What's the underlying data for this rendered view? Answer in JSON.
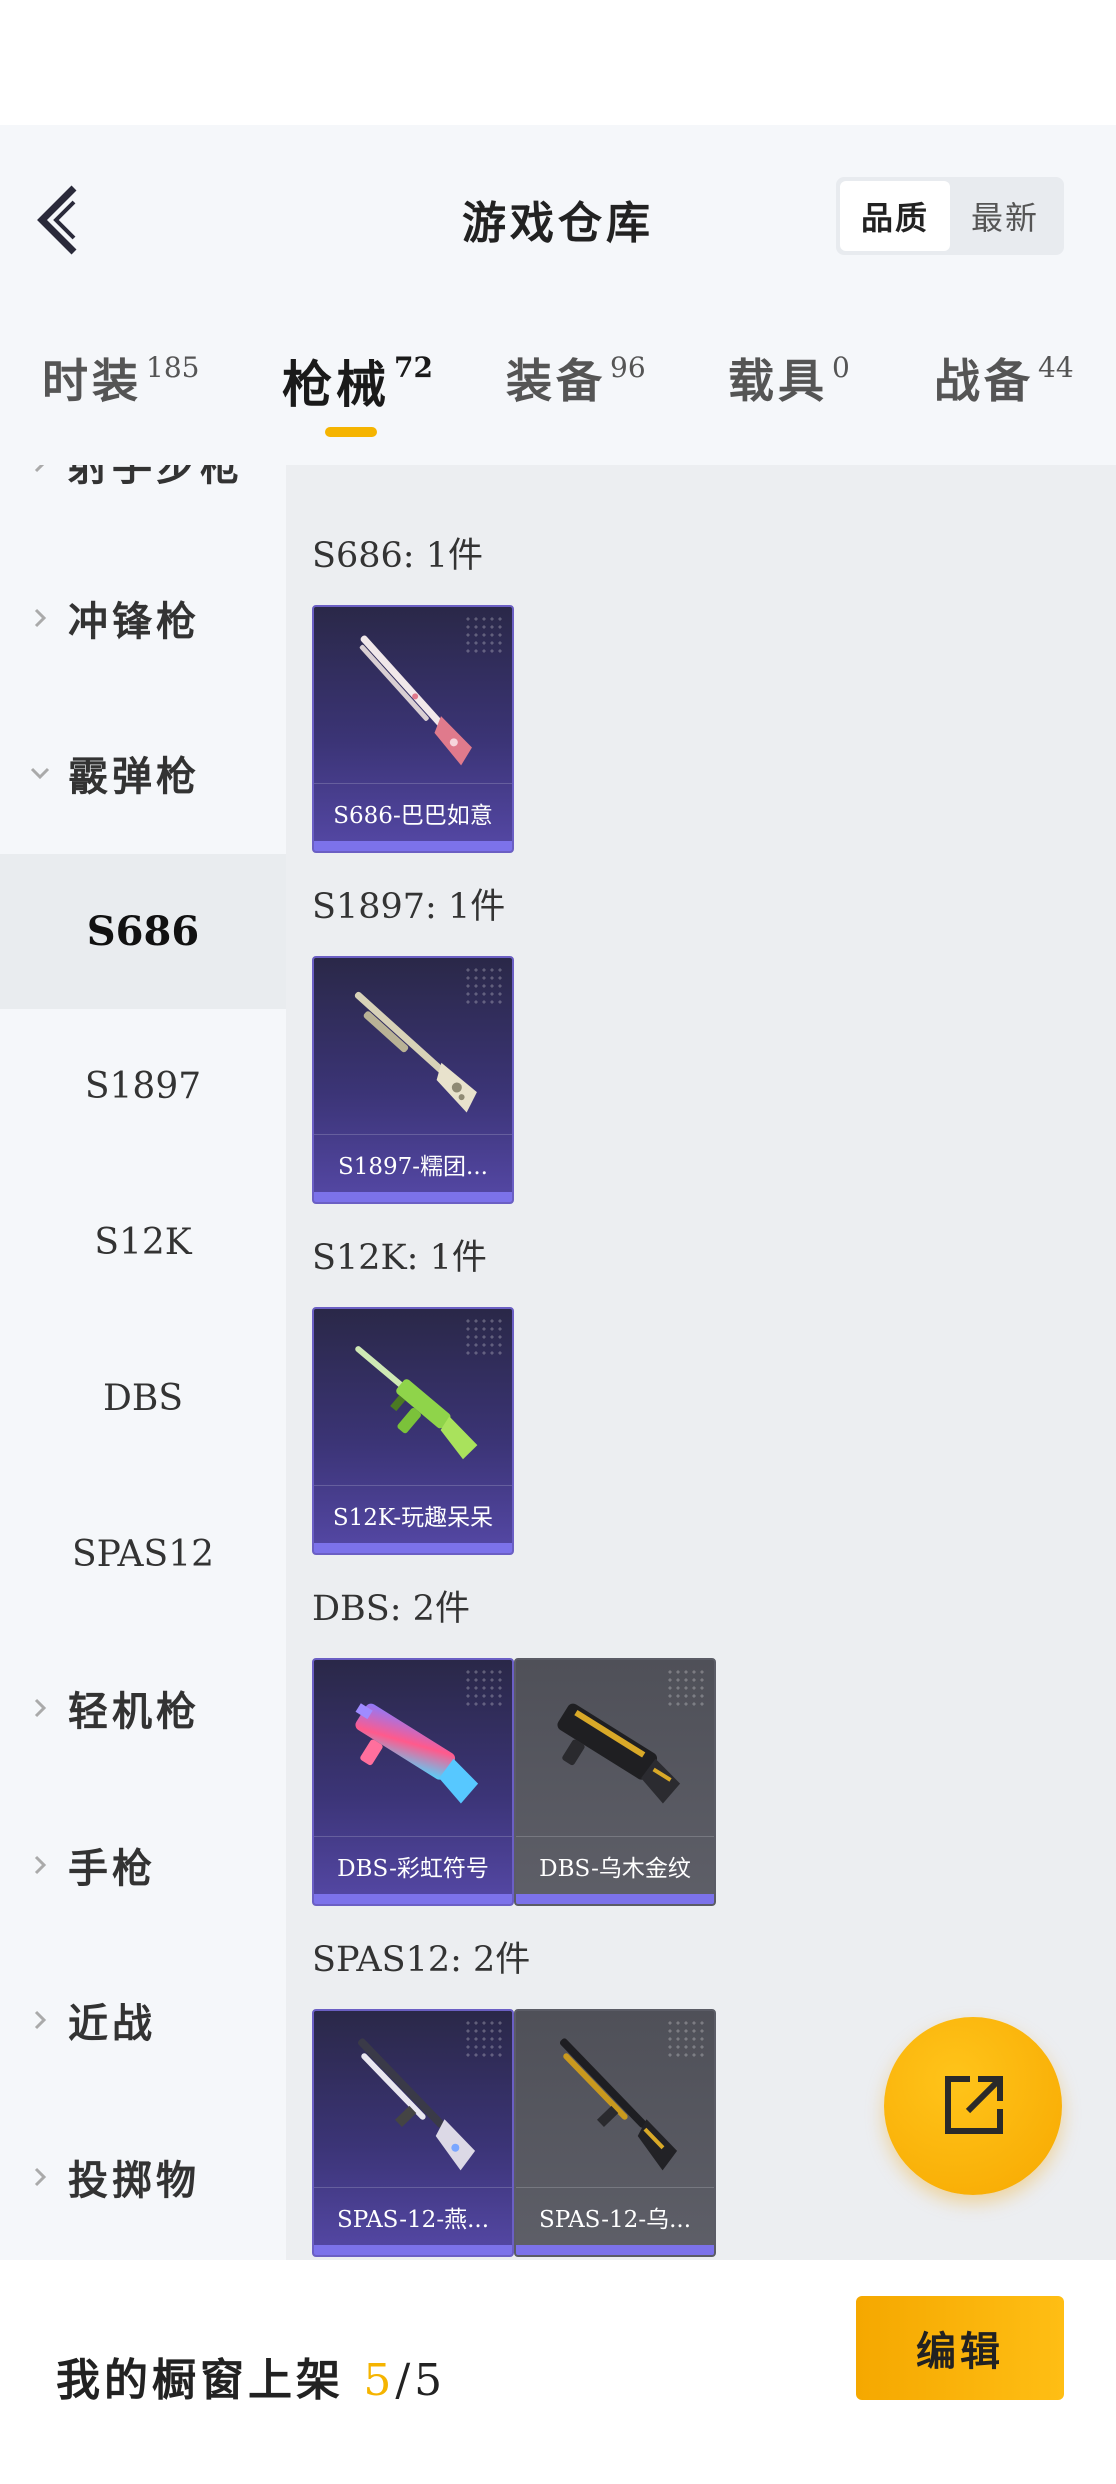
{
  "header": {
    "title": "游戏仓库",
    "sort_options": [
      "品质",
      "最新"
    ],
    "sort_active": "品质"
  },
  "tabs": [
    {
      "label": "时装",
      "count": "185"
    },
    {
      "label": "枪械",
      "count": "72",
      "active": true
    },
    {
      "label": "装备",
      "count": "96"
    },
    {
      "label": "载具",
      "count": "0"
    },
    {
      "label": "战备",
      "count": "44"
    }
  ],
  "sidebar": {
    "partial_top": "射手步枪",
    "categories": [
      {
        "label": "冲锋枪",
        "expanded": false
      },
      {
        "label": "霰弹枪",
        "expanded": true
      },
      {
        "label": "轻机枪",
        "expanded": false
      },
      {
        "label": "手枪",
        "expanded": false
      },
      {
        "label": "近战",
        "expanded": false
      },
      {
        "label": "投掷物",
        "expanded": false
      }
    ],
    "subitems": [
      "S686",
      "S1897",
      "S12K",
      "DBS",
      "SPAS12"
    ],
    "active_subitem": "S686"
  },
  "groups": [
    {
      "title": "S686: 1件",
      "items": [
        {
          "name": "S686-巴巴如意",
          "rarity": "purple"
        }
      ]
    },
    {
      "title": "S1897: 1件",
      "items": [
        {
          "name": "S1897-糯团...",
          "rarity": "purple"
        }
      ]
    },
    {
      "title": "S12K: 1件",
      "items": [
        {
          "name": "S12K-玩趣呆呆",
          "rarity": "purple"
        }
      ]
    },
    {
      "title": "DBS: 2件",
      "items": [
        {
          "name": "DBS-彩虹符号",
          "rarity": "purple"
        },
        {
          "name": "DBS-乌木金纹",
          "rarity": "gray"
        }
      ]
    },
    {
      "title": "SPAS12: 2件",
      "items": [
        {
          "name": "SPAS-12-燕...",
          "rarity": "purple"
        },
        {
          "name": "SPAS-12-乌...",
          "rarity": "gray"
        }
      ]
    }
  ],
  "footer": {
    "prefix": "我的橱窗上架 ",
    "current": "5",
    "separator": "/",
    "total": "5",
    "edit_label": "编辑"
  },
  "colors": {
    "accent": "#f5b400",
    "rarity_purple": "#5548a6",
    "rarity_gray": "#5e5f68",
    "background": "#eceef1"
  },
  "icons": {
    "back": "chevron-left-icon",
    "share": "share-external-icon"
  }
}
